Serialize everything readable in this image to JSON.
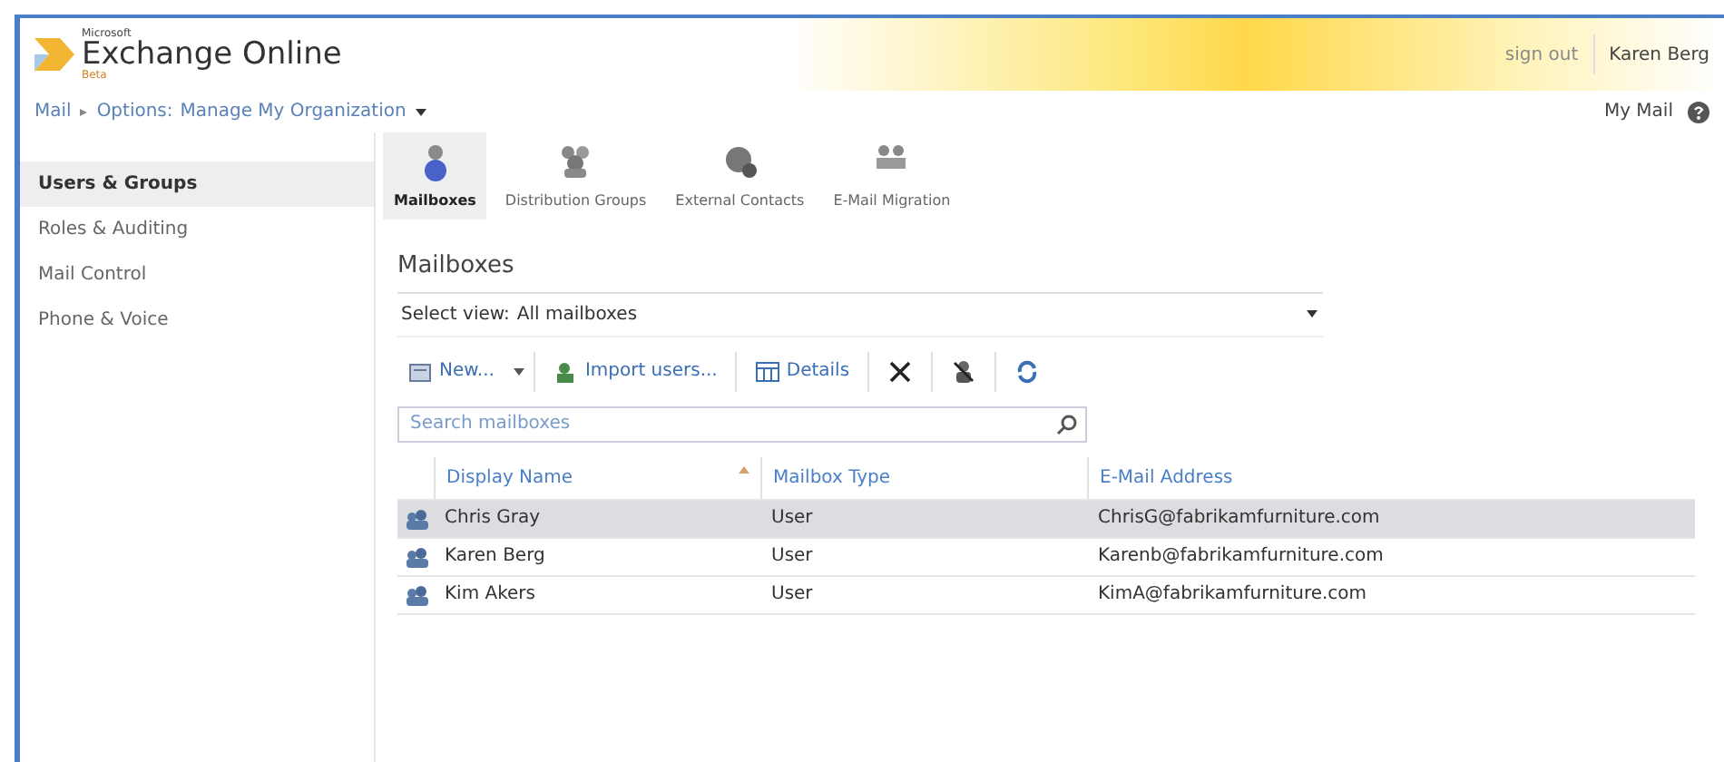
{
  "header": {
    "product": "Exchange Online",
    "maker": "Microsoft",
    "edition": "Beta",
    "links": [
      "sign out",
      "Karen Berg"
    ]
  },
  "breadcrumb": {
    "items": [
      "Mail",
      "Options:",
      "Manage My Organization"
    ],
    "right_link": "My Mail"
  },
  "sidebar": {
    "items": [
      {
        "label": "Users & Groups",
        "selected": true
      },
      {
        "label": "Roles & Auditing",
        "selected": false
      },
      {
        "label": "Mail Control",
        "selected": false
      },
      {
        "label": "Phone & Voice",
        "selected": false
      }
    ]
  },
  "tabs": [
    {
      "label": "Mailboxes",
      "kind": "user",
      "selected": true
    },
    {
      "label": "Distribution Groups",
      "kind": "group",
      "selected": false
    },
    {
      "label": "External Contacts",
      "kind": "contact",
      "selected": false
    },
    {
      "label": "E-Mail Migration",
      "kind": "migration",
      "selected": false
    }
  ],
  "section_title": "Mailboxes",
  "view": {
    "label": "Select view:",
    "value": "All mailboxes"
  },
  "toolbar": [
    {
      "kind": "new",
      "label": "New..."
    },
    {
      "kind": "import",
      "label": "Import users..."
    },
    {
      "kind": "details",
      "label": "Details"
    },
    {
      "kind": "delete"
    },
    {
      "kind": "user-remove"
    },
    {
      "kind": "refresh"
    }
  ],
  "search": {
    "placeholder": "Search mailboxes"
  },
  "table": {
    "columns": [
      "Display Name",
      "Mailbox Type",
      "E-Mail Address"
    ],
    "rows": [
      {
        "name": "Chris Gray",
        "type": "User",
        "email": "ChrisG@fabrikamfurniture.com",
        "selected": true
      },
      {
        "name": "Karen Berg",
        "type": "User",
        "email": "Karenb@fabrikamfurniture.com",
        "selected": false
      },
      {
        "name": "Kim Akers",
        "type": "User",
        "email": "KimA@fabrikamfurniture.com",
        "selected": false
      }
    ]
  }
}
